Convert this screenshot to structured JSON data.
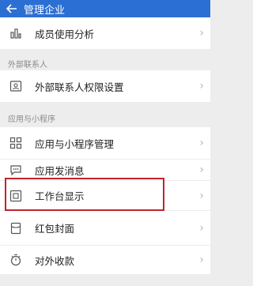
{
  "header": {
    "back_icon": "back-arrow-icon",
    "title": "管理企业"
  },
  "rows": {
    "member_usage": {
      "label": "成员使用分析",
      "icon": "bar-chart-icon"
    },
    "external_permissions": {
      "label": "外部联系人权限设置",
      "icon": "contact-card-icon"
    },
    "app_management": {
      "label": "应用与小程序管理",
      "icon": "grid-apps-icon"
    },
    "app_messages": {
      "label": "应用发消息",
      "icon": "chat-bubble-icon"
    },
    "workbench_display": {
      "label": "工作台显示",
      "icon": "window-stack-icon"
    },
    "red_packet_cover": {
      "label": "红包封面",
      "icon": "red-packet-icon"
    },
    "external_payment": {
      "label": "对外收款",
      "icon": "stopwatch-icon"
    }
  },
  "sections": {
    "external_contacts": "外部联系人",
    "apps_and_miniprograms": "应用与小程序"
  },
  "chevron": "›",
  "colors": {
    "header_bg": "#2c6fd4",
    "highlight_border": "#c0222a",
    "page_bg": "#ededed"
  }
}
